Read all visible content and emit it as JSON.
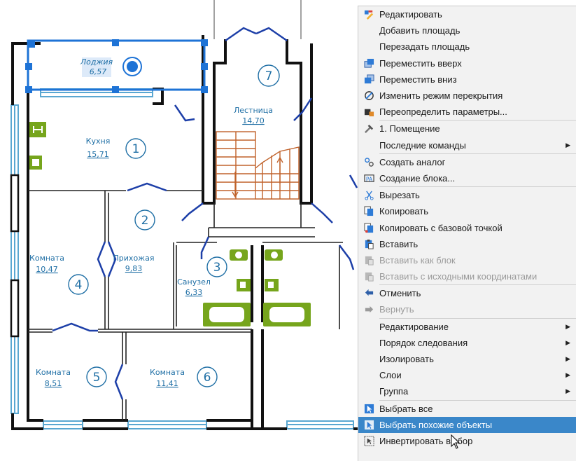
{
  "rooms": [
    {
      "name": "Лоджия",
      "area": "6,57",
      "num": ""
    },
    {
      "name": "Кухня",
      "area": "15,71",
      "num": "1"
    },
    {
      "name": "Лестница",
      "area": "14,70",
      "num": "7"
    },
    {
      "name": "",
      "area": "",
      "num": "2"
    },
    {
      "name": "Комната",
      "area": "10,47",
      "num": "4"
    },
    {
      "name": "Прихожая",
      "area": "9,83",
      "num": ""
    },
    {
      "name": "Санузел",
      "area": "6,33",
      "num": "3"
    },
    {
      "name": "Комната",
      "area": "8,51",
      "num": "5"
    },
    {
      "name": "Комната",
      "area": "11,41",
      "num": "6"
    }
  ],
  "menu": {
    "items": [
      {
        "label": "Редактировать",
        "icon": "edit-icon"
      },
      {
        "label": "Добавить площадь",
        "icon": ""
      },
      {
        "label": "Перезадать площадь",
        "icon": ""
      },
      {
        "label": "Переместить вверх",
        "icon": "move-up-icon"
      },
      {
        "label": "Переместить вниз",
        "icon": "move-down-icon"
      },
      {
        "label": "Изменить режим перекрытия",
        "icon": "overlap-mode-icon"
      },
      {
        "label": "Переопределить параметры...",
        "icon": "override-params-icon"
      },
      {
        "label": "1. Помещение",
        "icon": "hammer-icon"
      },
      {
        "label": "Последние команды",
        "icon": ""
      },
      {
        "label": "Создать аналог",
        "icon": "create-analog-icon"
      },
      {
        "label": "Создание блока...",
        "icon": "create-block-icon"
      },
      {
        "label": "Вырезать",
        "icon": "cut-icon"
      },
      {
        "label": "Копировать",
        "icon": "copy-icon"
      },
      {
        "label": "Копировать с базовой точкой",
        "icon": "copy-base-point-icon"
      },
      {
        "label": "Вставить",
        "icon": "paste-icon"
      },
      {
        "label": "Вставить как блок",
        "icon": "paste-block-icon"
      },
      {
        "label": "Вставить с исходными координатами",
        "icon": "paste-original-coords-icon"
      },
      {
        "label": "Отменить",
        "icon": "undo-icon"
      },
      {
        "label": "Вернуть",
        "icon": "redo-icon"
      },
      {
        "label": "Редактирование",
        "icon": ""
      },
      {
        "label": "Порядок следования",
        "icon": ""
      },
      {
        "label": "Изолировать",
        "icon": ""
      },
      {
        "label": "Слои",
        "icon": ""
      },
      {
        "label": "Группа",
        "icon": ""
      },
      {
        "label": "Выбрать все",
        "icon": "select-all-icon"
      },
      {
        "label": "Выбрать похожие объекты",
        "icon": "select-similar-icon"
      },
      {
        "label": "Инвертировать выбор",
        "icon": "invert-selection-icon"
      }
    ]
  },
  "colors": {
    "wall": "#111111",
    "door": "#1d3fa8",
    "window": "#5aa7d1",
    "text": "#1f6fa5",
    "fixture": "#76a51c",
    "stair": "#c0622b",
    "grip": "#1e73d6",
    "menu_bg": "#f2f2f2",
    "menu_highlight": "#3a87c9"
  }
}
